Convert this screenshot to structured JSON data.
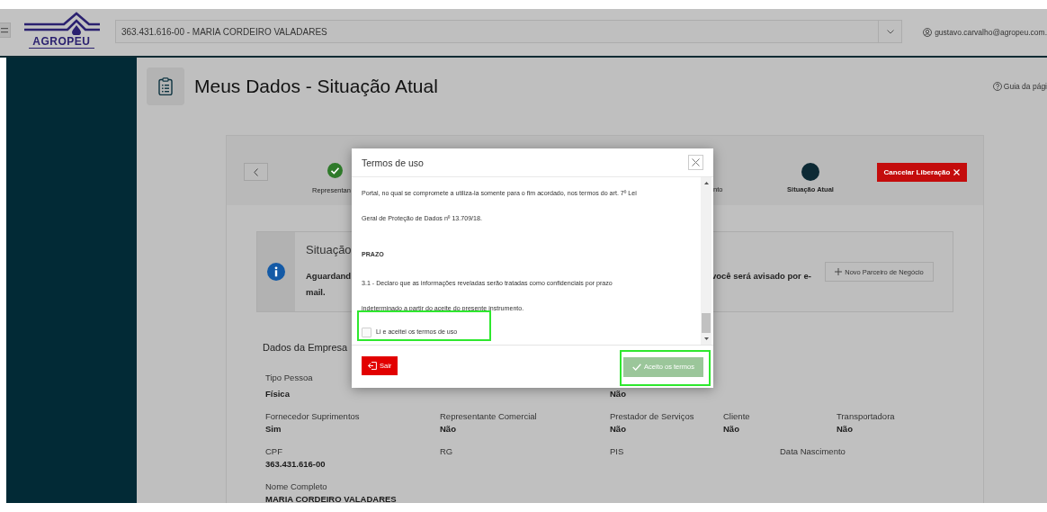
{
  "header": {
    "logo": "AGROPEU",
    "account_select": {
      "value": "363.431.616-00 - MARIA CORDEIRO VALADARES"
    },
    "user": "gustavo.carvalho@agropeu.com."
  },
  "page": {
    "title": "Meus Dados - Situação Atual",
    "help": "Guia da pági"
  },
  "stepper": {
    "steps": [
      {
        "label": "Representan",
        "completed": true
      },
      {
        "label": "nto"
      },
      {
        "label": "Situação Atual",
        "current": true
      }
    ],
    "cancel_button": "Cancelar Liberação"
  },
  "status_panel": {
    "title": "Situação",
    "message_lines": [
      "Aguardand",
      "mail."
    ],
    "message_right": "você será avisado por e-",
    "button": "Novo Parceiro de Negócio"
  },
  "company": {
    "title": "Dados da Empresa",
    "rows": [
      {
        "cells": [
          {
            "label": "Tipo Pessoa",
            "value": "Física"
          },
          null,
          {
            "value": "Não"
          }
        ]
      },
      {
        "cells": [
          {
            "label": "Fornecedor Suprimentos",
            "value": "Sim"
          },
          {
            "label": "Representante Comercial",
            "value": "Não"
          },
          {
            "label": "Prestador de Serviços",
            "value": "Não"
          },
          {
            "label": "Cliente",
            "value": "Não"
          },
          {
            "label": "Transportadora",
            "value": "Não"
          }
        ]
      },
      {
        "cells": [
          {
            "label": "CPF",
            "value": "363.431.616-00"
          },
          {
            "label": "RG"
          },
          {
            "label": "PIS"
          },
          {
            "label": "Data Nascimento"
          }
        ]
      },
      {
        "cells": [
          {
            "label": "Nome Completo",
            "value": "MARIA CORDEIRO VALADARES"
          }
        ]
      }
    ]
  },
  "modal": {
    "title": "Termos de uso",
    "lines": [
      {
        "kind": "text",
        "text": "Portal, no qual se compromete a utiliza-la somente para o fim acordado, nos termos do art. 7º Lei"
      },
      {
        "kind": "text",
        "text": "Geral de Proteção de Dados nº 13.709/18."
      },
      {
        "kind": "heading",
        "text": "PRAZO"
      },
      {
        "kind": "text",
        "text": "3.1 - Declaro que as informações reveladas serão tratadas como confidenciais por prazo"
      },
      {
        "kind": "text",
        "text": "indeterminado a partir do aceite do presente instrumento."
      }
    ],
    "checkbox": {
      "label": "Li e aceitei os termos de uso",
      "checked": false,
      "highlighted": true
    },
    "buttons": [
      {
        "kind": "exit",
        "label": "Sair",
        "disabled": false,
        "highlighted": false
      },
      {
        "kind": "accept",
        "label": "Aceito os termos",
        "disabled": true,
        "highlighted": true
      }
    ]
  }
}
